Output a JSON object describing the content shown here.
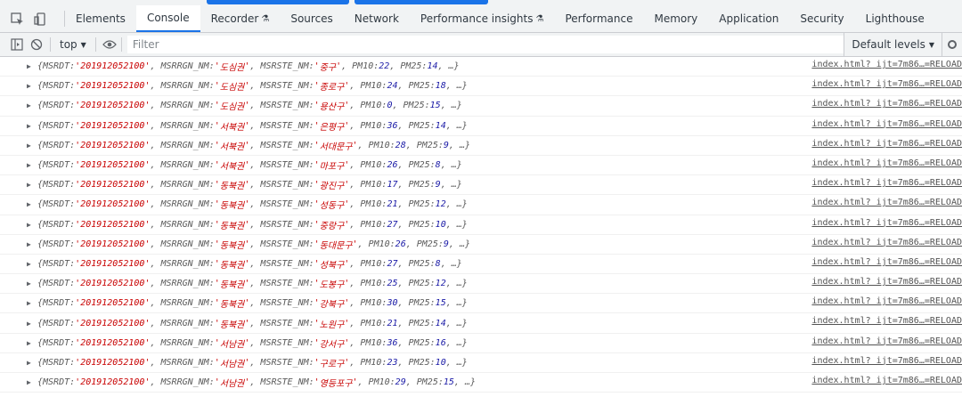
{
  "tabs": [
    "Elements",
    "Console",
    "Recorder",
    "Sources",
    "Network",
    "Performance insights",
    "Performance",
    "Memory",
    "Application",
    "Security",
    "Lighthouse"
  ],
  "active_tab": "Console",
  "toolbar": {
    "context": "top",
    "filter_placeholder": "Filter",
    "levels": "Default levels"
  },
  "colors": {
    "accent": "#1a73e8",
    "string": "#c80000",
    "number": "#1a1aa6"
  },
  "log_source": "index.html? ijt=7m86…=RELOAD",
  "rows": [
    {
      "date": "201912052100",
      "region": "도심권",
      "station": "중구",
      "pm10": "22",
      "pm25": "14"
    },
    {
      "date": "201912052100",
      "region": "도심권",
      "station": "종로구",
      "pm10": "24",
      "pm25": "18"
    },
    {
      "date": "201912052100",
      "region": "도심권",
      "station": "용산구",
      "pm10": "0",
      "pm25": "15"
    },
    {
      "date": "201912052100",
      "region": "서북권",
      "station": "은평구",
      "pm10": "36",
      "pm25": "14"
    },
    {
      "date": "201912052100",
      "region": "서북권",
      "station": "서대문구",
      "pm10": "28",
      "pm25": "9"
    },
    {
      "date": "201912052100",
      "region": "서북권",
      "station": "마포구",
      "pm10": "26",
      "pm25": "8"
    },
    {
      "date": "201912052100",
      "region": "동북권",
      "station": "광진구",
      "pm10": "17",
      "pm25": "9"
    },
    {
      "date": "201912052100",
      "region": "동북권",
      "station": "성동구",
      "pm10": "21",
      "pm25": "12"
    },
    {
      "date": "201912052100",
      "region": "동북권",
      "station": "중랑구",
      "pm10": "27",
      "pm25": "10"
    },
    {
      "date": "201912052100",
      "region": "동북권",
      "station": "동대문구",
      "pm10": "26",
      "pm25": "9"
    },
    {
      "date": "201912052100",
      "region": "동북권",
      "station": "성북구",
      "pm10": "27",
      "pm25": "8"
    },
    {
      "date": "201912052100",
      "region": "동북권",
      "station": "도봉구",
      "pm10": "25",
      "pm25": "12"
    },
    {
      "date": "201912052100",
      "region": "동북권",
      "station": "강북구",
      "pm10": "30",
      "pm25": "15"
    },
    {
      "date": "201912052100",
      "region": "동북권",
      "station": "노원구",
      "pm10": "21",
      "pm25": "14"
    },
    {
      "date": "201912052100",
      "region": "서남권",
      "station": "강서구",
      "pm10": "36",
      "pm25": "16"
    },
    {
      "date": "201912052100",
      "region": "서남권",
      "station": "구로구",
      "pm10": "23",
      "pm25": "10"
    },
    {
      "date": "201912052100",
      "region": "서남권",
      "station": "영등포구",
      "pm10": "29",
      "pm25": "15"
    }
  ]
}
